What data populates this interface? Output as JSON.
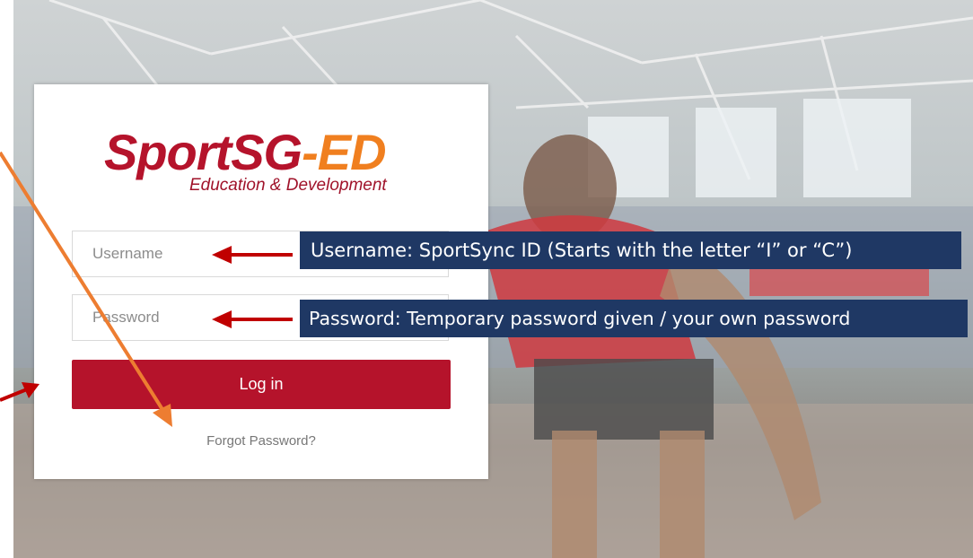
{
  "logo": {
    "brand_sport": "SportSG",
    "brand_ed": "-ED",
    "tagline": "Education & Development"
  },
  "form": {
    "username_placeholder": "Username",
    "password_placeholder": "Password",
    "login_label": "Log in",
    "forgot_label": "Forgot Password?"
  },
  "callouts": {
    "username_note": "Username: SportSync ID (Starts with the letter “I” or “C”)",
    "password_note": "Password: Temporary password given / your own password"
  },
  "colors": {
    "brand_red": "#b5132b",
    "brand_orange": "#f07f1f",
    "callout_navy": "#1f3864",
    "annotation_arrow_orange": "#ed7d31",
    "annotation_arrow_red": "#c00000"
  }
}
